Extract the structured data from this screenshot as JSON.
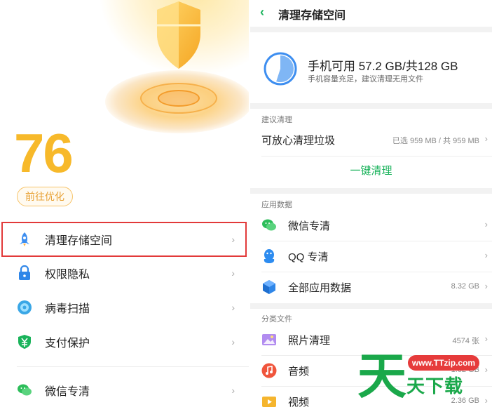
{
  "left": {
    "score": "76",
    "optimize_label": "前往优化",
    "menu": [
      {
        "label": "清理存储空间",
        "icon": "rocket-icon",
        "highlighted": true
      },
      {
        "label": "权限隐私",
        "icon": "lock-icon"
      },
      {
        "label": "病毒扫描",
        "icon": "scan-icon"
      },
      {
        "label": "支付保护",
        "icon": "yen-shield-icon"
      },
      {
        "label": "微信专清",
        "icon": "wechat-icon"
      }
    ],
    "chevron": "›"
  },
  "right": {
    "back_glyph": "‹",
    "title": "清理存储空间",
    "storage_main": "手机可用 57.2 GB/共128 GB",
    "storage_sub": "手机容量充足，建议清理无用文件",
    "storage_used_fraction": 0.55,
    "sections": {
      "suggest": "建议清理",
      "app_data": "应用数据",
      "categories": "分类文件"
    },
    "junk": {
      "label": "可放心清理垃圾",
      "value": "已选 959 MB / 共 959 MB"
    },
    "one_click": "一键清理",
    "apps": [
      {
        "label": "微信专清",
        "icon": "wechat-icon",
        "value": ""
      },
      {
        "label": "QQ 专清",
        "icon": "qq-icon",
        "value": ""
      },
      {
        "label": "全部应用数据",
        "icon": "cube-icon",
        "value": "8.32 GB"
      }
    ],
    "files": [
      {
        "label": "照片清理",
        "icon": "photo-icon",
        "value": "4574 张"
      },
      {
        "label": "音频",
        "icon": "music-icon",
        "value": "1.02 GB"
      },
      {
        "label": "视频",
        "icon": "video-icon",
        "value": "2.36 GB"
      }
    ],
    "chevron": "›"
  },
  "watermark": {
    "big_char": "天",
    "url": "www.TTzip.com",
    "name": "天下载"
  },
  "colors": {
    "accent_green": "#1bb35c",
    "score_orange": "#f7b92a",
    "highlight_red": "#e23a3a"
  }
}
